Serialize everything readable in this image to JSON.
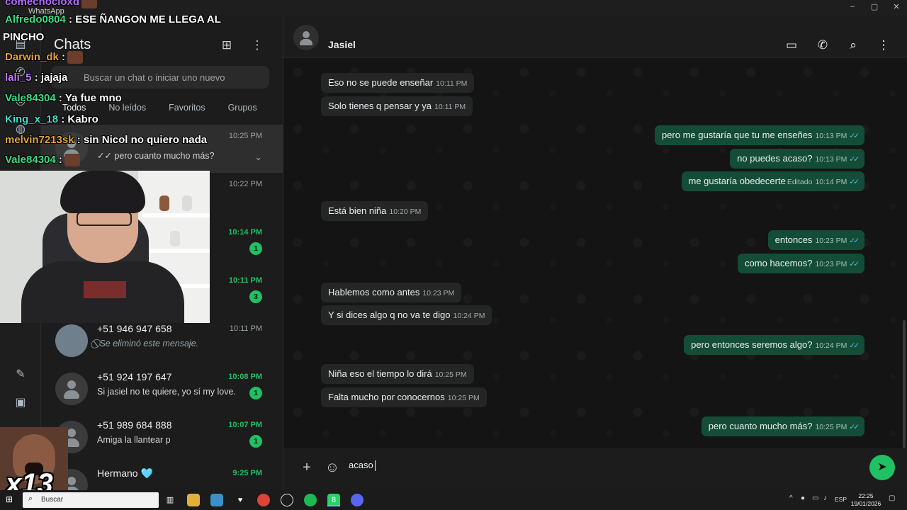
{
  "window": {
    "app_name": "WhatsApp",
    "controls": [
      "–",
      "▢",
      "✕"
    ]
  },
  "sidebar": {
    "title": "Chats",
    "search_placeholder": "Buscar un chat o iniciar uno nuevo",
    "filters": [
      "Todos",
      "No leídos",
      "Favoritos",
      "Grupos"
    ],
    "chats": [
      {
        "name": "",
        "preview": "✓✓ pero cuanto mucho más?",
        "time": "10:25 PM",
        "unread": ""
      },
      {
        "name": "",
        "preview": "",
        "time": "10:22 PM",
        "unread": ""
      },
      {
        "name": "",
        "preview": "",
        "time": "10:14 PM",
        "unread": "1"
      },
      {
        "name": "",
        "preview": "",
        "time": "10:11 PM",
        "unread": "3"
      },
      {
        "name": "+51 946 947 658",
        "preview": "⃠ Se eliminó este mensaje.",
        "time": "10:11 PM",
        "unread": ""
      },
      {
        "name": "+51 924 197 647",
        "preview": "Si jasiel no te quiere, yo sí my love.",
        "time": "10:08 PM",
        "unread": "1"
      },
      {
        "name": "+51 989 684 888",
        "preview": "Amiga la llantear p",
        "time": "10:07 PM",
        "unread": "1"
      },
      {
        "name": "Hermano 🩵",
        "preview": "",
        "time": "9:25 PM",
        "unread": ""
      }
    ]
  },
  "chat": {
    "contact_name": "Jasiel",
    "messages": [
      {
        "dir": "in",
        "text": "Eso no se puede enseñar",
        "time": "10:11 PM",
        "edited": ""
      },
      {
        "dir": "in",
        "text": "Solo tienes q pensar y ya",
        "time": "10:11 PM",
        "edited": ""
      },
      {
        "dir": "out",
        "text": "pero me gustaría que tu me enseñes",
        "time": "10:13 PM",
        "edited": ""
      },
      {
        "dir": "out",
        "text": "no puedes acaso?",
        "time": "10:13 PM",
        "edited": ""
      },
      {
        "dir": "out",
        "text": "me gustaría obedecerte",
        "time": "10:14 PM",
        "edited": "Editado"
      },
      {
        "dir": "in",
        "text": "Está bien niña",
        "time": "10:20 PM",
        "edited": ""
      },
      {
        "dir": "out",
        "text": "entonces",
        "time": "10:23 PM",
        "edited": ""
      },
      {
        "dir": "out",
        "text": "como hacemos?",
        "time": "10:23 PM",
        "edited": ""
      },
      {
        "dir": "in",
        "text": "Hablemos como antes",
        "time": "10:23 PM",
        "edited": ""
      },
      {
        "dir": "in",
        "text": "Y si dices algo q no va te digo",
        "time": "10:24 PM",
        "edited": ""
      },
      {
        "dir": "out",
        "text": "pero entonces seremos algo?",
        "time": "10:24 PM",
        "edited": ""
      },
      {
        "dir": "in",
        "text": "Niña eso el tiempo lo dirá",
        "time": "10:25 PM",
        "edited": ""
      },
      {
        "dir": "in",
        "text": "Falta mucho por conocernos",
        "time": "10:25 PM",
        "edited": ""
      },
      {
        "dir": "out",
        "text": "pero cuanto mucho más?",
        "time": "10:25 PM",
        "edited": ""
      }
    ],
    "composer_text": "acaso"
  },
  "stream_chat": [
    {
      "user": "comecnocloxd",
      "text": "",
      "color": "#b36bff"
    },
    {
      "user": "Alfredo0804",
      "text": "ESE ÑANGON ME LLEGA AL",
      "color": "#3ddc84"
    },
    {
      "user": "",
      "text": "PINCHO",
      "color": "#ffffff"
    },
    {
      "user": "Darwin_dk",
      "text": "",
      "color": "#e3a23a"
    },
    {
      "user": "lali_5",
      "text": "jajaja",
      "color": "#c27cff"
    },
    {
      "user": "Vale84304",
      "text": "Ya fue mno",
      "color": "#3ddc84"
    },
    {
      "user": "King_x_18",
      "text": "Kabro",
      "color": "#3ddcc8"
    },
    {
      "user": "melvin7213sk",
      "text": "sin Nicol no quiero nada",
      "color": "#e3a23a"
    },
    {
      "user": "Vale84304",
      "text": "",
      "color": "#3ddc84"
    }
  ],
  "overlay_badge": "x13",
  "taskbar": {
    "search_placeholder": "Buscar",
    "language": "ESP",
    "time": "22:25",
    "date": "19/01/2026",
    "whatsapp_count": "8"
  },
  "colors": {
    "accent": "#21c063",
    "outgoing_bubble": "#144d37",
    "incoming_bubble": "#242626"
  }
}
